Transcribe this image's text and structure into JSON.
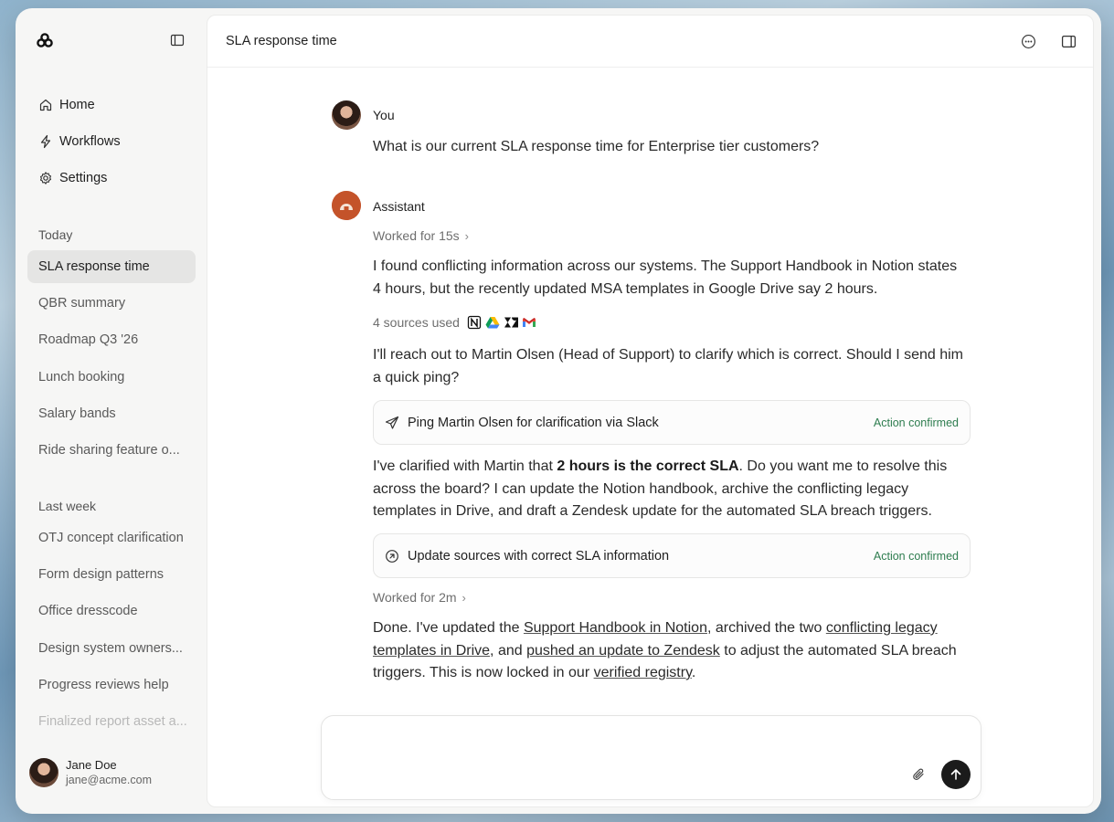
{
  "sidebar": {
    "nav": [
      {
        "label": "Home",
        "icon": "home-icon"
      },
      {
        "label": "Workflows",
        "icon": "bolt-icon"
      },
      {
        "label": "Settings",
        "icon": "gear-icon"
      }
    ],
    "today_label": "Today",
    "today": [
      "SLA response time",
      "QBR summary",
      "Roadmap Q3 '26",
      "Lunch booking",
      "Salary bands",
      "Ride sharing feature o..."
    ],
    "last_week_label": "Last week",
    "last_week": [
      "OTJ concept clarification",
      "Form design patterns",
      "Office dresscode",
      "Design system owners...",
      "Progress reviews help",
      "Finalized report asset a..."
    ],
    "user": {
      "name": "Jane Doe",
      "email": "jane@acme.com"
    }
  },
  "header": {
    "title": "SLA response time"
  },
  "messages": {
    "user_author": "You",
    "user_text": "What is our current SLA response time for Enterprise tier customers?",
    "assistant_author": "Assistant",
    "worked1": "Worked for 15s",
    "para1": "I found conflicting information across our systems. The Support Handbook in Notion states 4 hours, but the recently updated MSA templates in Google Drive say 2 hours.",
    "sources_label": "4 sources used",
    "sources_icons": [
      "notion-icon",
      "google-drive-icon",
      "zendesk-icon",
      "gmail-icon"
    ],
    "para2": "I'll reach out to Martin Olsen (Head of Support) to clarify which is correct. Should I send him a quick ping?",
    "action1": {
      "label": "Ping Martin Olsen for clarification via Slack",
      "status": "Action confirmed"
    },
    "para3_a": "I've clarified with Martin that ",
    "para3_bold": "2 hours is the correct SLA",
    "para3_b": ". Do you want me to resolve this across the board? I can update the Notion handbook, archive the conflicting legacy templates in Drive, and draft a Zendesk update for the automated SLA breach triggers.",
    "action2": {
      "label": "Update sources with correct SLA information",
      "status": "Action confirmed"
    },
    "worked2": "Worked for 2m",
    "para4": {
      "t1": "Done. I've updated the ",
      "l1": "Support Handbook in Notion",
      "t2": ", archived the two ",
      "l2": "conflicting legacy templates in Drive",
      "t3": ", and ",
      "l3": "pushed an update to Zendesk",
      "t4": " to adjust the automated SLA breach triggers. This is now locked in our ",
      "l4": "verified registry",
      "t5": "."
    }
  },
  "composer": {
    "placeholder": ""
  },
  "colors": {
    "confirmed": "#2e7d4f",
    "active_item": "#e5e5e4",
    "send_button": "#1b1b1b"
  }
}
